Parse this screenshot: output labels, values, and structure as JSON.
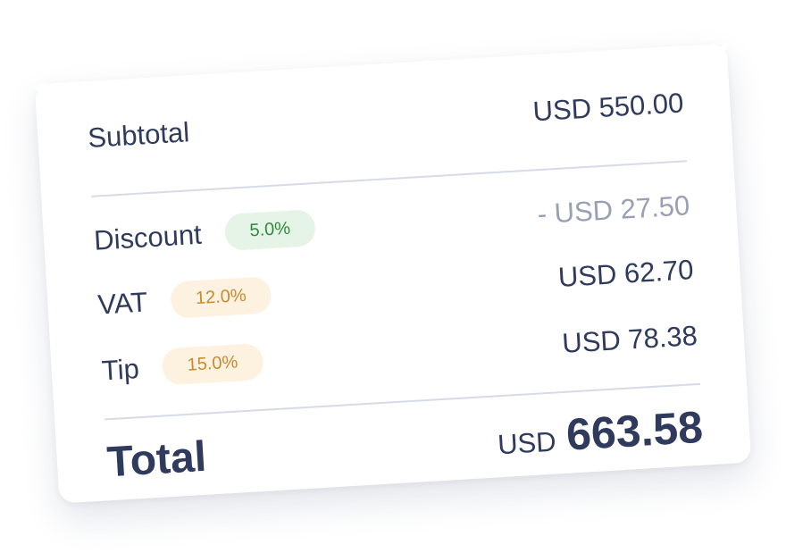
{
  "summary": {
    "subtotal": {
      "label": "Subtotal",
      "amount": "USD 550.00"
    },
    "discount": {
      "label": "Discount",
      "rate": "5.0%",
      "amount": "- USD 27.50"
    },
    "vat": {
      "label": "VAT",
      "rate": "12.0%",
      "amount": "USD 62.70"
    },
    "tip": {
      "label": "Tip",
      "rate": "15.0%",
      "amount": "USD 78.38"
    },
    "total": {
      "label": "Total",
      "currency": "USD",
      "value": "663.58"
    }
  },
  "colors": {
    "text": "#2f3a5c",
    "muted": "#9aa0b3",
    "discount_badge_bg": "#e6f4e8",
    "discount_badge_text": "#2e8a3a",
    "tax_badge_bg": "#fdf1e0",
    "tax_badge_text": "#c98a2e",
    "divider": "#d7dbe8"
  }
}
